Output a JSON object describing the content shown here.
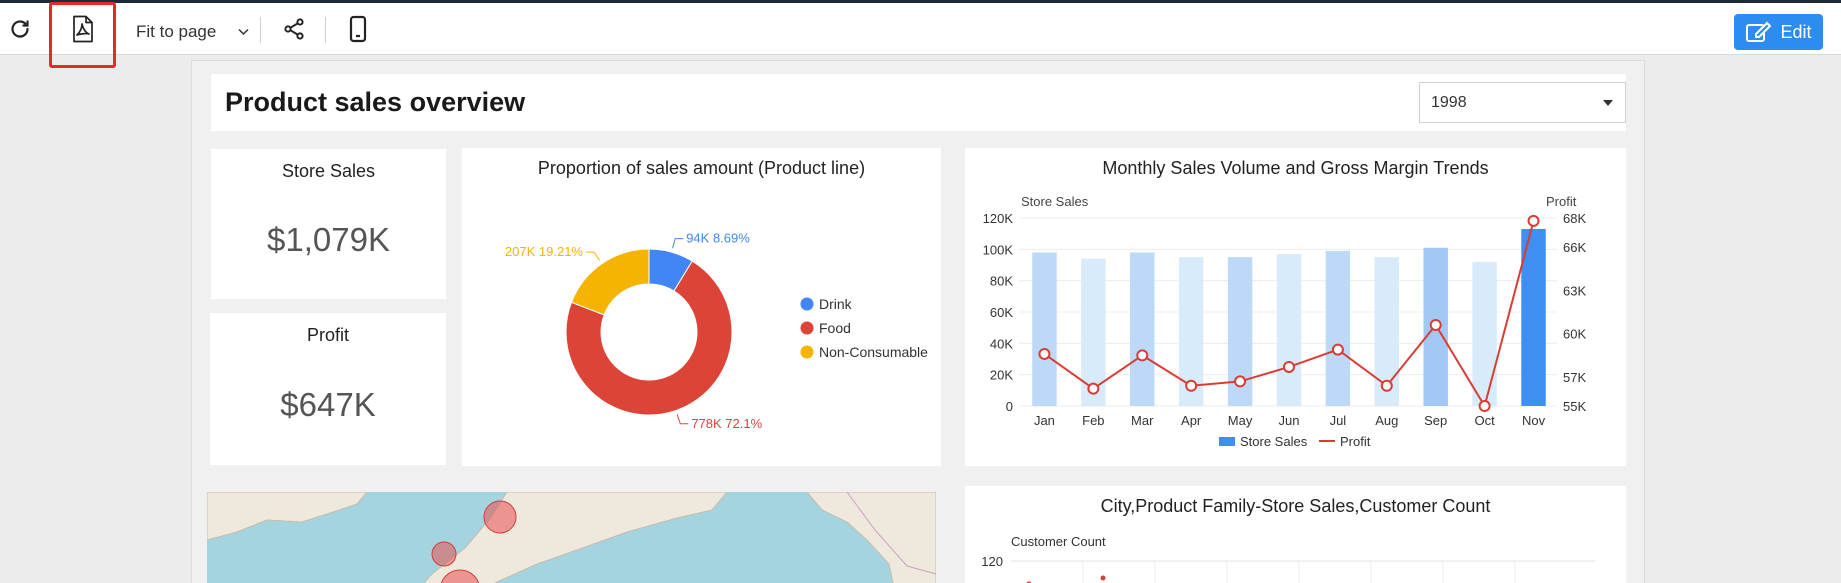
{
  "toolbar": {
    "refresh_icon": "refresh-icon",
    "pdf_icon": "pdf-export-icon",
    "fit_label": "Fit to page",
    "share_icon": "share-icon",
    "mobile_icon": "mobile-icon",
    "edit_label": "Edit",
    "accent": "#2d8cf0",
    "highlight_color": "#e8262b"
  },
  "dashboard": {
    "title": "Product sales overview",
    "year": "1998"
  },
  "kpis": [
    {
      "title": "Store Sales",
      "value": "$1,079K"
    },
    {
      "title": "Profit",
      "value": "$647K"
    }
  ],
  "chart_data": [
    {
      "type": "pie",
      "title": "Proportion of sales amount (Product line)",
      "legend": [
        "Drink",
        "Food",
        "Non-Consumable"
      ],
      "colors": [
        "#4285f4",
        "#db4437",
        "#f4b400"
      ],
      "values": [
        94,
        778,
        207
      ],
      "labels": [
        "94K 8.69%",
        "778K 72.1%",
        "207K 19.21%"
      ],
      "legend_position": "right"
    },
    {
      "type": "bar",
      "title": "Monthly Sales Volume and Gross Margin Trends",
      "categories": [
        "Jan",
        "Feb",
        "Mar",
        "Apr",
        "May",
        "Jun",
        "Jul",
        "Aug",
        "Sep",
        "Oct",
        "Nov"
      ],
      "ylabel": "Store Sales",
      "y2label": "Profit",
      "yticks": [
        "0",
        "20K",
        "40K",
        "60K",
        "80K",
        "100K",
        "120K"
      ],
      "y2ticks": [
        "55K",
        "57K",
        "60K",
        "63K",
        "66K",
        "68K"
      ],
      "ylim": [
        0,
        120000
      ],
      "y2lim": [
        55000,
        68000
      ],
      "series": [
        {
          "name": "Store Sales",
          "type": "bar",
          "values": [
            98000,
            94000,
            98000,
            95000,
            95000,
            97000,
            99000,
            95000,
            101000,
            92000,
            113000
          ]
        },
        {
          "name": "Profit",
          "type": "line",
          "values": [
            58600,
            56200,
            58500,
            56400,
            56700,
            57700,
            58900,
            56400,
            60600,
            55000,
            67800
          ]
        }
      ],
      "legend": [
        "Store Sales",
        "Profit"
      ],
      "legend_position": "bottom"
    },
    {
      "type": "scatter",
      "title": "City,Product Family-Store Sales,Customer Count",
      "ylabel": "Customer Count",
      "yticks": [
        "120"
      ]
    }
  ]
}
